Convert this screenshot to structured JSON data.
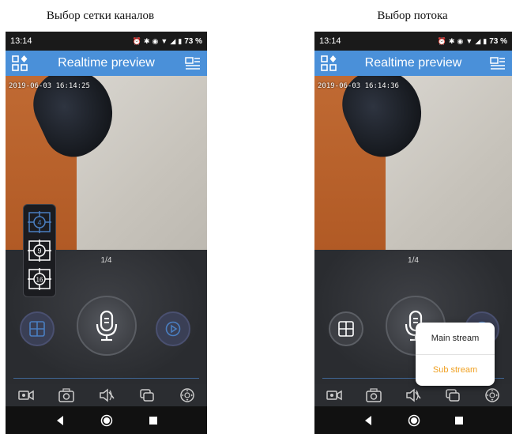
{
  "captions": {
    "left": "Выбор сетки каналов",
    "right": "Выбор потока"
  },
  "status_bar": {
    "time": "13:14",
    "battery": "73 %"
  },
  "header": {
    "title": "Realtime preview"
  },
  "left_phone": {
    "timestamp": "2019-06-03 16:14:25",
    "page_indicator": "1/4",
    "grid_options": [
      "4",
      "9",
      "16"
    ]
  },
  "right_phone": {
    "timestamp": "2019-06-03 16:14:36",
    "page_indicator": "1/4",
    "stream_options": {
      "main": "Main stream",
      "sub": "Sub stream"
    }
  },
  "colors": {
    "header": "#4a90d9",
    "accent": "#4a7fc1",
    "sub_stream": "#f0a020"
  }
}
